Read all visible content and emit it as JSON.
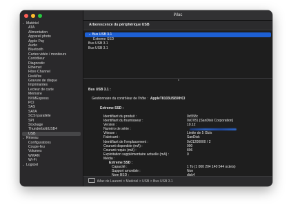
{
  "window": {
    "title": "iMac"
  },
  "sidebar": {
    "items": [
      {
        "label": "Matériel",
        "type": "group"
      },
      {
        "label": "ATA"
      },
      {
        "label": "Alimentation"
      },
      {
        "label": "Appareil photo"
      },
      {
        "label": "Apple Pay"
      },
      {
        "label": "Audio"
      },
      {
        "label": "Bluetooth"
      },
      {
        "label": "Cartes vidéo / moniteurs"
      },
      {
        "label": "Contrôleur"
      },
      {
        "label": "Diagnostic"
      },
      {
        "label": "Ethernet"
      },
      {
        "label": "Fibre Channel"
      },
      {
        "label": "FireWire"
      },
      {
        "label": "Gravure de disque"
      },
      {
        "label": "Imprimantes"
      },
      {
        "label": "Lecteur de carte"
      },
      {
        "label": "Mémoire"
      },
      {
        "label": "NVMExpress"
      },
      {
        "label": "PCI"
      },
      {
        "label": "SAS"
      },
      {
        "label": "SATA"
      },
      {
        "label": "SCSI parallèle"
      },
      {
        "label": "SPI"
      },
      {
        "label": "Stockage"
      },
      {
        "label": "Thunderbolt/USB4"
      },
      {
        "label": "USB",
        "selected": true
      },
      {
        "label": "Réseau",
        "type": "group"
      },
      {
        "label": "Configurations"
      },
      {
        "label": "Coupe-feu"
      },
      {
        "label": "Volumes"
      },
      {
        "label": "WWAN"
      },
      {
        "label": "Wi-Fi"
      },
      {
        "label": "Logiciel",
        "type": "group"
      }
    ]
  },
  "device_tree": {
    "header": "Arborescence du périphérique USB",
    "rows": [
      {
        "label": "Bus USB 3.1",
        "selected": true,
        "expanded": true
      },
      {
        "label": "Extreme SSD",
        "child": true
      },
      {
        "label": "Bus USB 3.1"
      },
      {
        "label": "Bus USB 3.1"
      }
    ]
  },
  "details": {
    "bus_title": "Bus USB 3.1 :",
    "controller_label": "Gestionnaire du contrôleur de l'hôte :",
    "controller_value": "AppleT8103USBXHCI",
    "ssd_title": "Extreme SSD :",
    "properties": [
      {
        "k": "Identifiant du produit :",
        "v": "0x558c"
      },
      {
        "k": "Identifiant du fournisseur :",
        "v": "0x0781  (SanDisk Corporation)"
      },
      {
        "k": "Version :",
        "v": "10.12"
      },
      {
        "k": "Numéro de série :",
        "v": "",
        "blurred": true
      },
      {
        "k": "Vitesse :",
        "v": "Limite de 5 Gb/s"
      },
      {
        "k": "Fabricant :",
        "v": "SanDisk"
      },
      {
        "k": "Identifiant de l'emplacement :",
        "v": "0x01200000 / 2"
      },
      {
        "k": "Courant disponible (mA) :",
        "v": "900"
      },
      {
        "k": "Courant requis (mA) :",
        "v": "896"
      },
      {
        "k": "Exploitation supplémentaire actuelle (mA) :",
        "v": "0"
      },
      {
        "k": "Média :",
        "v": ""
      },
      {
        "k": "Extreme SSD :",
        "v": "",
        "sub": true
      },
      {
        "k": "Capacité :",
        "v": "1 To (1 000 204 140 544 octets)",
        "sub2": true
      },
      {
        "k": "Support amovible :",
        "v": "Non",
        "sub2": true
      },
      {
        "k": "Nom BSD :",
        "v": "disk4",
        "sub2": true
      },
      {
        "k": "Logical Unit :",
        "v": "0",
        "sub2": true
      }
    ]
  },
  "pathbar": {
    "text": "iMac de Laurent  >  Matériel  >  USB  >  Bus USB 3.1"
  },
  "colors": {
    "selection": "#1d5fd3",
    "window_bg": "#1e1e1e"
  }
}
